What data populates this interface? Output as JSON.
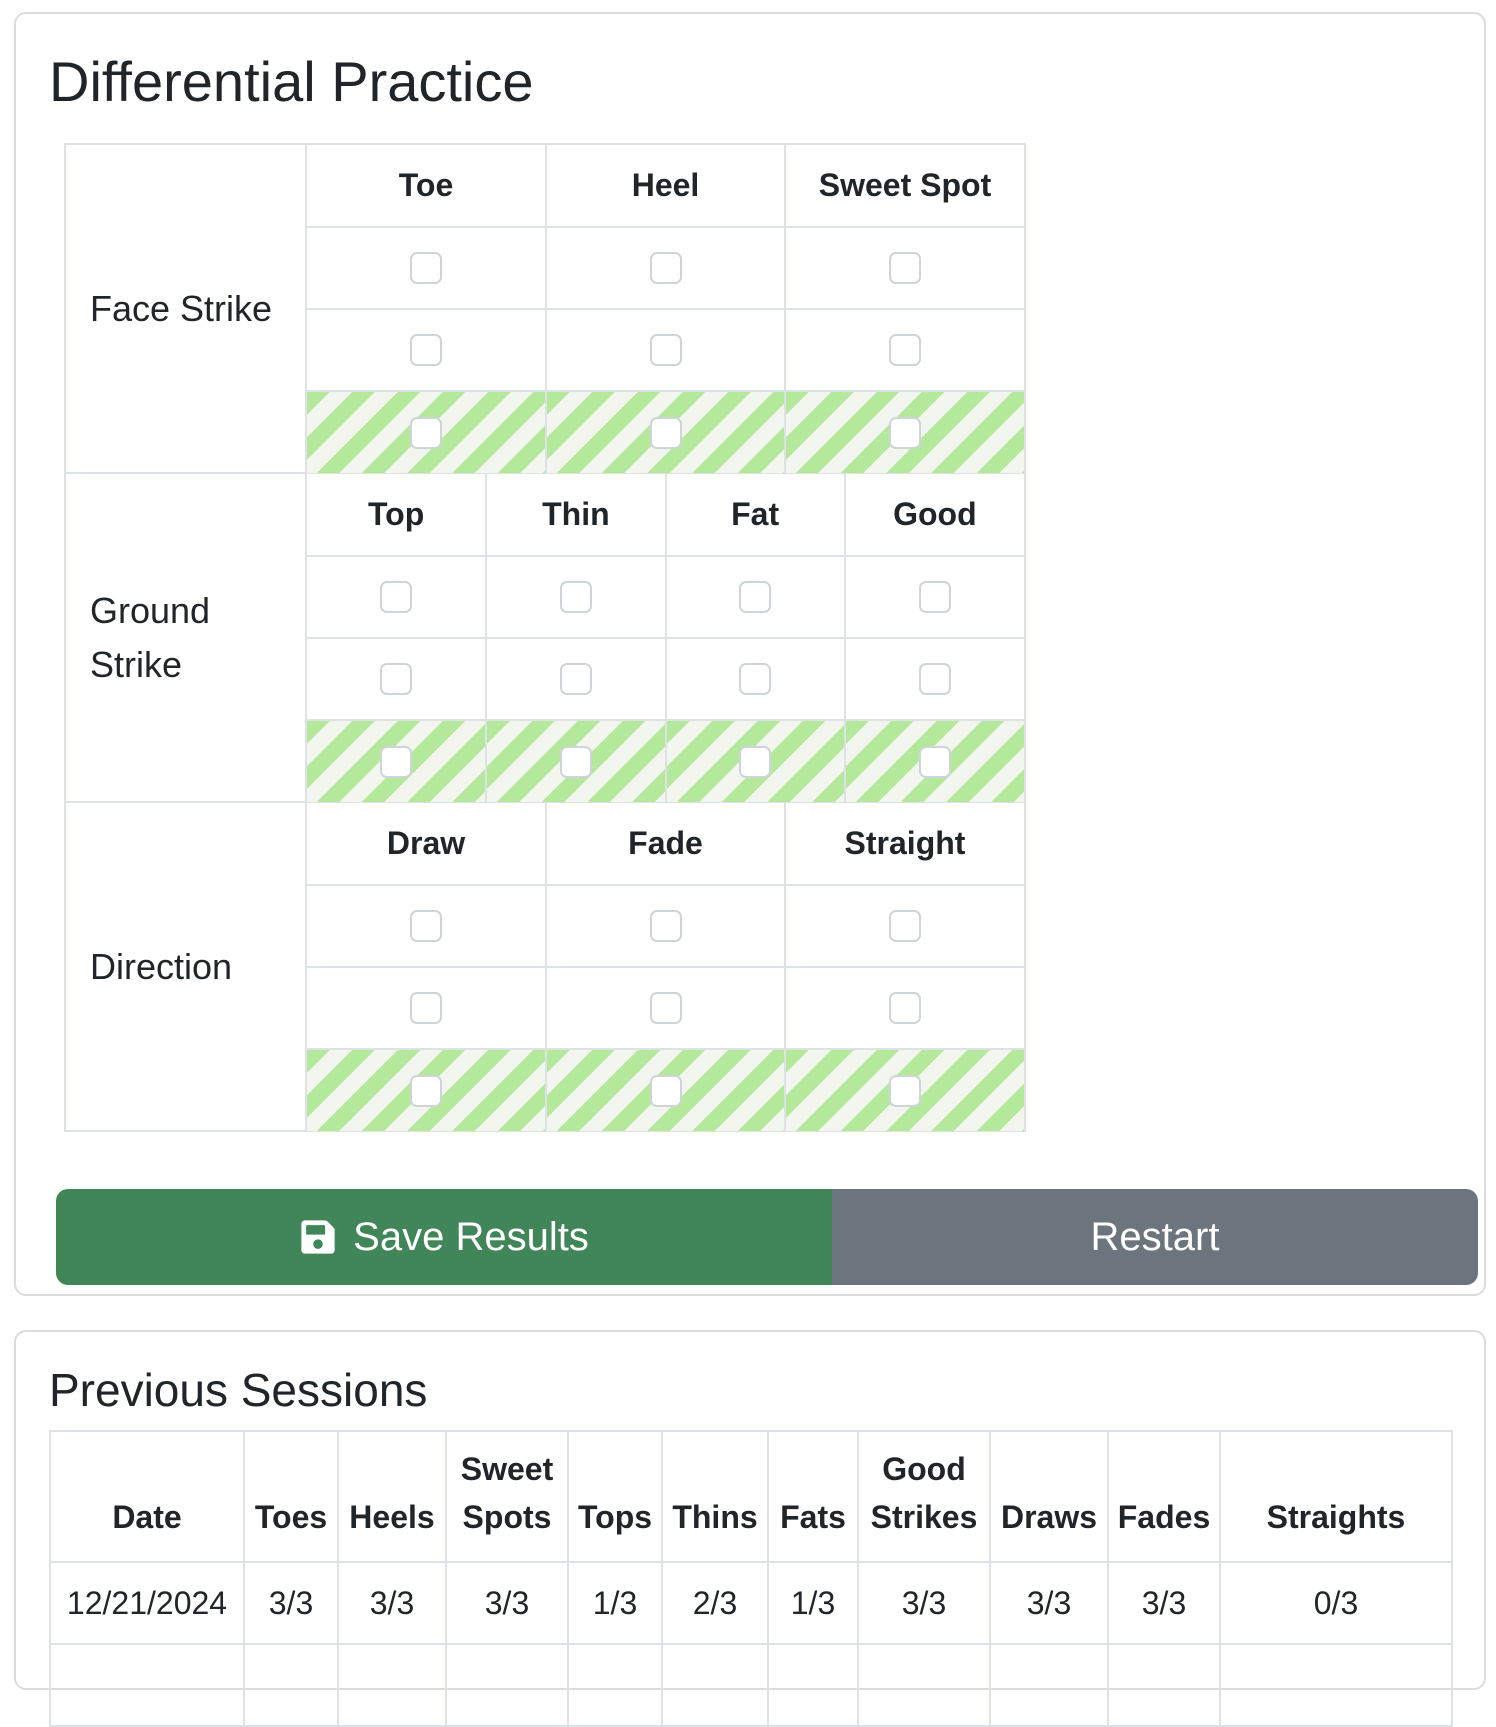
{
  "practice": {
    "title": "Differential Practice",
    "sections": [
      {
        "label": "Face Strike",
        "columns": [
          "Toe",
          "Heel",
          "Sweet Spot"
        ]
      },
      {
        "label": "Ground Strike",
        "columns": [
          "Top",
          "Thin",
          "Fat",
          "Good"
        ]
      },
      {
        "label": "Direction",
        "columns": [
          "Draw",
          "Fade",
          "Straight"
        ]
      }
    ],
    "rows_per_section": 3,
    "striped_row": "last",
    "stripe_colors": [
      "#b4e89a",
      "#f2f6ee"
    ],
    "save_label": "Save Results",
    "save_icon": "floppy-disk-icon",
    "restart_label": "Restart",
    "colors": {
      "save": "#418658",
      "restart": "#6c757d"
    }
  },
  "sessions": {
    "title": "Previous Sessions",
    "headers": [
      "Date",
      "Toes",
      "Heels",
      "Sweet Spots",
      "Tops",
      "Thins",
      "Fats",
      "Good Strikes",
      "Draws",
      "Fades",
      "Straights"
    ],
    "rows": [
      [
        "12/21/2024",
        "3/3",
        "3/3",
        "3/3",
        "1/3",
        "2/3",
        "1/3",
        "3/3",
        "3/3",
        "3/3",
        "0/3"
      ]
    ]
  }
}
